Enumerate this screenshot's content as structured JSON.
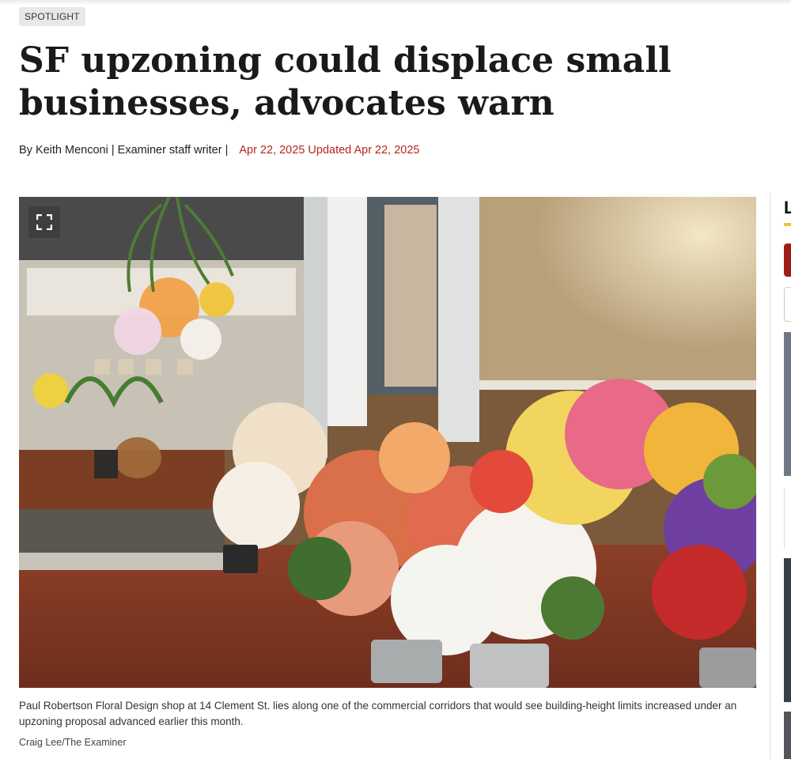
{
  "article": {
    "tag": "SPOTLIGHT",
    "headline": "SF upzoning could displace small businesses, advocates warn",
    "byline": "By Keith Menconi | Examiner staff writer |",
    "date": "Apr 22, 2025 Updated Apr 22, 2025"
  },
  "photo": {
    "caption": "Paul Robertson Floral Design shop at 14 Clement St. lies along one of the commercial corridors that would see building-height limits increased under an upzoning proposal advanced earlier this month.",
    "credit": "Craig Lee/The Examiner",
    "expand_icon": "expand-icon"
  },
  "sidebar": {
    "heading_initial": "L"
  },
  "colors": {
    "date": "#b5261e",
    "tag_bg": "#e8e8e8",
    "rail_accent": "#f2c230",
    "rail_button": "#a01e18"
  }
}
